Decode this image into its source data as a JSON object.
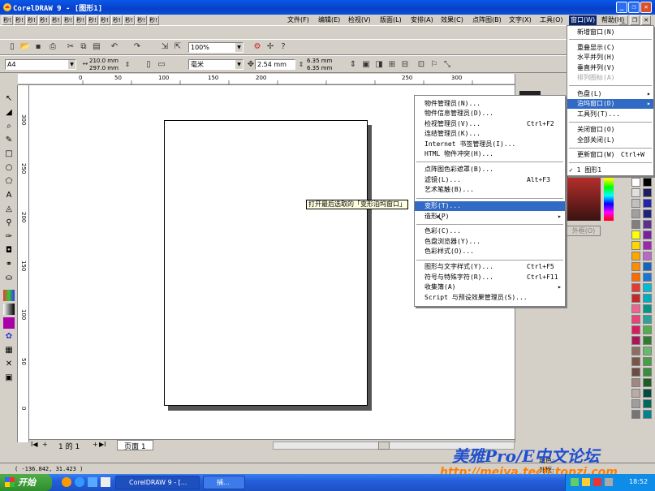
{
  "window": {
    "title": "CorelDRAW 9 - [图形1]",
    "minimize": "_",
    "restore": "❐",
    "close": "✕"
  },
  "menubar": {
    "tool_buttons": [
      "秒!",
      "秒!",
      "秒!",
      "秒!",
      "秒!",
      "秒!",
      "秒!",
      "秒!",
      "秒!",
      "秒!",
      "秒!",
      "秒!",
      "秒!"
    ],
    "items": [
      "文件(F)",
      "编辑(E)",
      "检视(V)",
      "版面(L)",
      "安排(A)",
      "效果(C)",
      "点阵图(B)",
      "文字(X)",
      "工具(O)",
      "窗口(W)",
      "帮助(H)"
    ],
    "doc_buttons": [
      "_",
      "❐",
      "✕"
    ]
  },
  "standard_toolbar": {
    "zoom": "100%"
  },
  "property_bar": {
    "page_size": "A4",
    "width": "210.0 mm",
    "height": "297.0 mm",
    "units": "毫米",
    "nudge": "2.54 mm",
    "dup_x": "6.35 mm",
    "dup_y": "6.35 mm"
  },
  "rulers": {
    "h_ticks": [
      "0",
      "50",
      "100",
      "150",
      "200",
      "250",
      "300"
    ],
    "v_ticks": [
      "300",
      "250",
      "200",
      "150",
      "100",
      "50",
      "0"
    ]
  },
  "page_nav": {
    "first": "I◀",
    "prev": "◀",
    "add": "+",
    "label": "1 的 1",
    "next": "▶",
    "last": "▶I",
    "tab": "页面 1"
  },
  "status": {
    "coords": "( -136.842, 31.423 )",
    "fill_label": "填色:",
    "outline_label": "外框:",
    "outline_tab": "外框(O)"
  },
  "tooltip": "打开最后选取的「变形泊坞窗口」",
  "window_menu": {
    "items": [
      {
        "label": "新增窗口(N)",
        "shortcut": ""
      },
      {
        "label": "重叠显示(C)",
        "shortcut": ""
      },
      {
        "label": "水平并列(H)",
        "shortcut": ""
      },
      {
        "label": "垂直并列(V)",
        "shortcut": ""
      },
      {
        "label": "排列图标(A)",
        "shortcut": ""
      },
      {
        "label": "色盘(L)",
        "shortcut": "▸"
      },
      {
        "label": "泊坞窗口(D)",
        "shortcut": "▸"
      },
      {
        "label": "工具列(T)...",
        "shortcut": ""
      },
      {
        "label": "关闭窗口(O)",
        "shortcut": ""
      },
      {
        "label": "全部关闭(L)",
        "shortcut": ""
      },
      {
        "label": "更新窗口(W)",
        "shortcut": "Ctrl+W"
      },
      {
        "label": "✓ 1 图形1",
        "shortcut": ""
      }
    ]
  },
  "docker_menu": {
    "items": [
      {
        "label": "物件管理员(N)...",
        "shortcut": ""
      },
      {
        "label": "物件信息管理员(D)...",
        "shortcut": ""
      },
      {
        "label": "检视管理员(V)...",
        "shortcut": "Ctrl+F2"
      },
      {
        "label": "连结管理员(K)...",
        "shortcut": ""
      },
      {
        "label": "Internet 书签管理员(I)...",
        "shortcut": ""
      },
      {
        "label": "HTML 物件冲突(H)...",
        "shortcut": ""
      },
      {
        "label": "点阵图色彩遮罩(B)...",
        "shortcut": ""
      },
      {
        "label": "滤镜(L)...",
        "shortcut": "Alt+F3"
      },
      {
        "label": "艺术笔触(B)...",
        "shortcut": ""
      },
      {
        "label": "变形(T)...",
        "shortcut": ""
      },
      {
        "label": "造形(P)",
        "shortcut": "▸"
      },
      {
        "label": "色彩(C)...",
        "shortcut": ""
      },
      {
        "label": "色盘浏览器(Y)...",
        "shortcut": ""
      },
      {
        "label": "色彩样式(O)...",
        "shortcut": ""
      },
      {
        "label": "图形与文字样式(Y)...",
        "shortcut": "Ctrl+F5"
      },
      {
        "label": "符号与特殊字符(R)...",
        "shortcut": "Ctrl+F11"
      },
      {
        "label": "收集簿(A)",
        "shortcut": "▸"
      },
      {
        "label": "Script 与预设效果管理员(S)...",
        "shortcut": ""
      }
    ]
  },
  "taskbar": {
    "start": "开始",
    "items": [
      "CorelDRAW 9 - [...",
      "捕..."
    ],
    "clock": "18:52"
  },
  "watermark": {
    "line1": "美雅Pro/E中文论坛",
    "line2": "http://meiya.tech.topzj.com"
  },
  "colors": {
    "title_blue": "#0a58e8",
    "menu_highlight": "#316ac5",
    "accent_red": "#d8512c"
  }
}
